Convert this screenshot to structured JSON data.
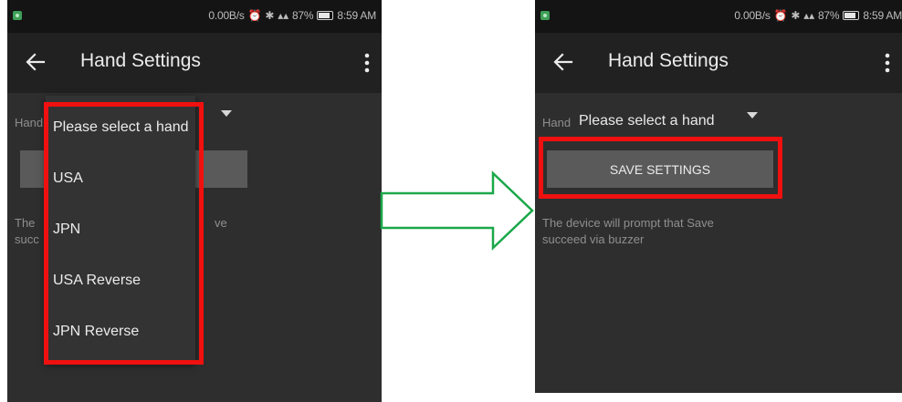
{
  "status": {
    "network_speed": "0.00B/s",
    "battery": "87%",
    "time": "8:59 AM"
  },
  "left": {
    "title": "Hand Settings",
    "hand_label": "Hand",
    "info_line1": "The",
    "info_line1_end": "ve",
    "info_line2": "succ",
    "dropdown_options": [
      "Please select a hand",
      "USA",
      "JPN",
      "USA Reverse",
      "JPN Reverse"
    ]
  },
  "right": {
    "title": "Hand Settings",
    "hand_label": "Hand",
    "dropdown_value": "Please select a hand",
    "save_label": "SAVE SETTINGS",
    "info_line1": "The device will prompt that Save",
    "info_line2": "succeed via buzzer"
  },
  "colors": {
    "highlight": "#f01010",
    "arrow": "#1aa84a",
    "background": "#2e2e2e",
    "toolbar": "#212121",
    "button": "#5a5a5a"
  },
  "icons": [
    "back-arrow-icon",
    "overflow-menu-icon",
    "alarm-icon",
    "bluetooth-icon",
    "signal-icon",
    "battery-icon",
    "dropdown-caret-icon",
    "transition-arrow-icon"
  ]
}
